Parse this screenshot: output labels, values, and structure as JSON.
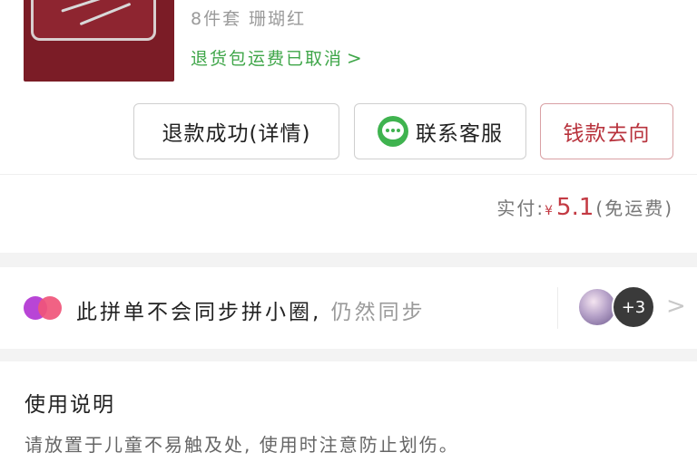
{
  "product": {
    "spec": "8件套 珊瑚红",
    "return_shipping": "退货包运费已取消",
    "colors": {
      "thumbnail_bg": "#7b1c26",
      "link_green": "#3fa649"
    }
  },
  "actions": {
    "refund_label": "退款成功(详情)",
    "service_label": "联系客服",
    "money_label": "钱款去向"
  },
  "payment": {
    "label": "实付:",
    "currency": "¥",
    "amount": "5.1",
    "note": "(免运费)",
    "accent": "#c33a43"
  },
  "circle": {
    "text": "此拼单不会同步拼小圈,",
    "muted_text": "仍然同步",
    "extra_count": "+3"
  },
  "usage": {
    "title": "使用说明",
    "body": "请放置于儿童不易触及处, 使用时注意防止划伤。"
  },
  "icons": {
    "wechat": "wechat-chat-icon",
    "chevron": "chevron-right-icon"
  }
}
